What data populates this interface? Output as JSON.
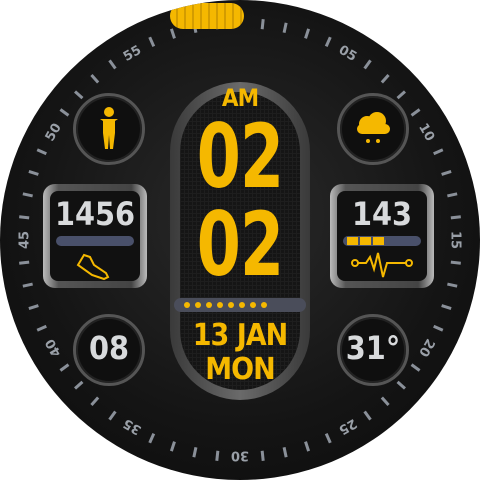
{
  "bezel": {
    "labels": [
      "05",
      "10",
      "15",
      "20",
      "25",
      "30",
      "35",
      "40",
      "45",
      "50",
      "55"
    ]
  },
  "time": {
    "ampm": "AM",
    "hour": "02",
    "minute": "02"
  },
  "date": {
    "day_month": "13 JAN",
    "weekday": "MON"
  },
  "battery": {
    "dots_filled": 8,
    "dots_total": 8
  },
  "steps": {
    "value": "1456",
    "progress": 0,
    "icon": "shoe-icon"
  },
  "heart_rate": {
    "value": "143",
    "segments_filled": 3,
    "segments_total": 8,
    "icon": "heartbeat-icon"
  },
  "top_left": {
    "icon": "person-icon"
  },
  "top_right": {
    "icon": "weather-cloud-rain-icon"
  },
  "bottom_left": {
    "value": "08"
  },
  "bottom_right": {
    "value": "31°"
  },
  "colors": {
    "accent": "#f5b800",
    "text": "#d8dadc",
    "bar": "#49506a"
  }
}
